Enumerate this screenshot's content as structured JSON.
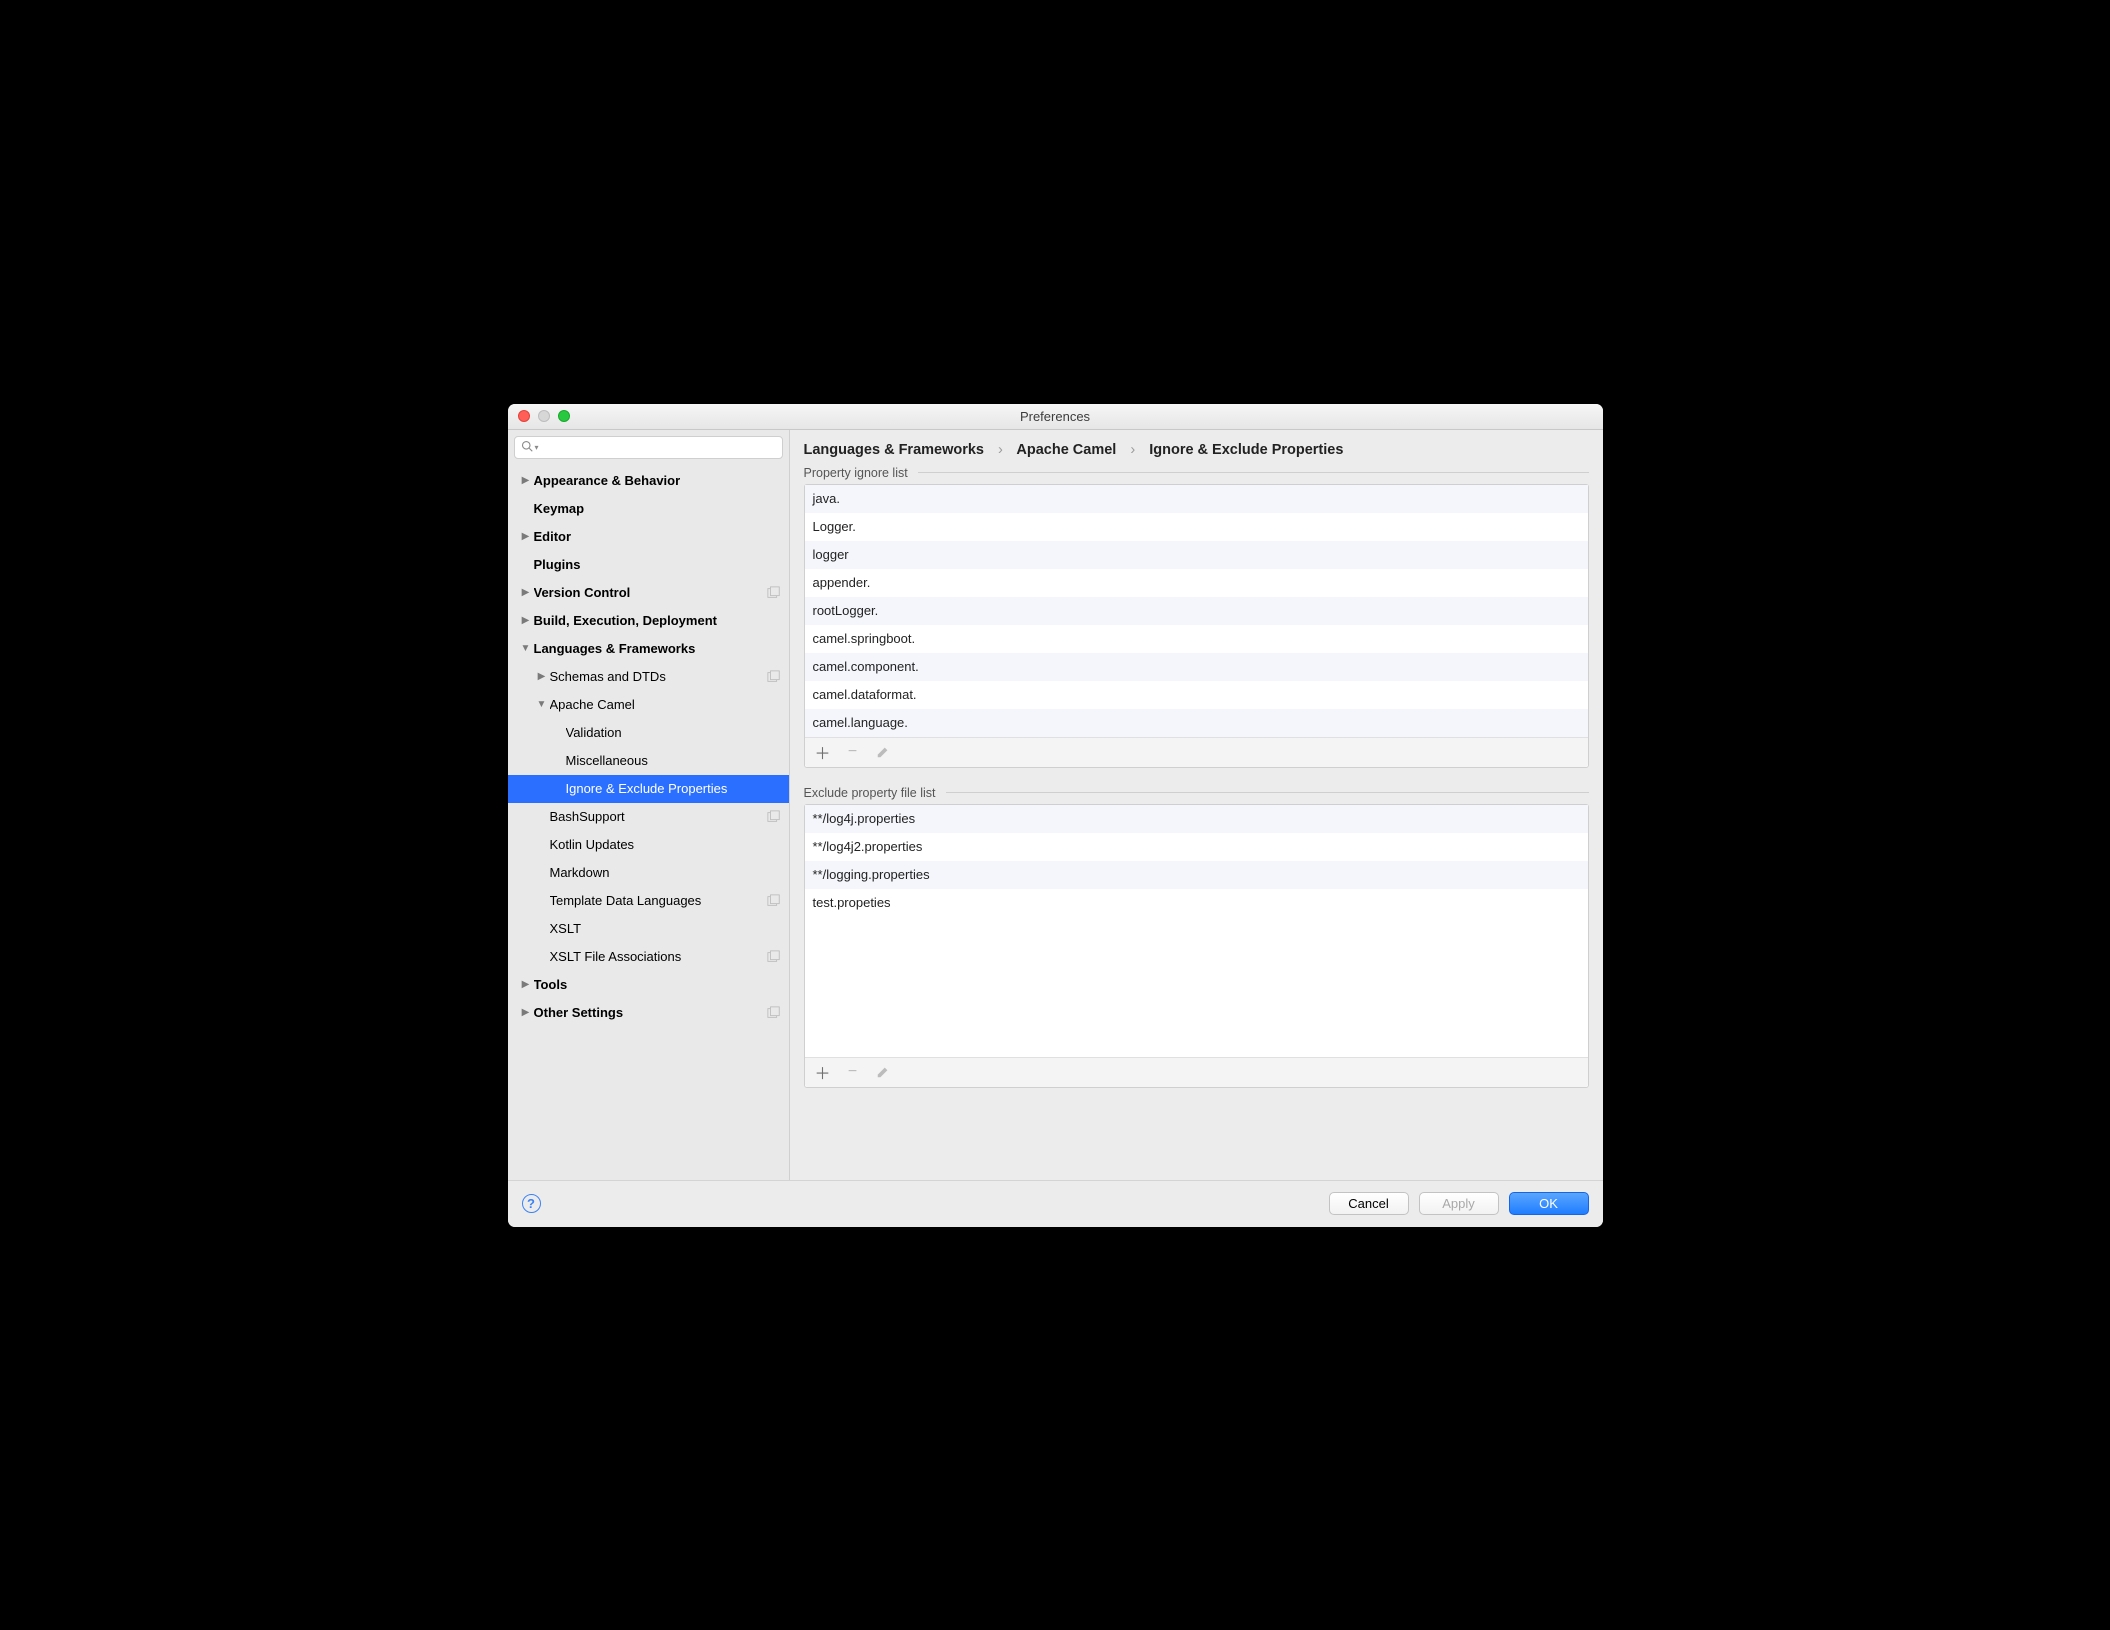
{
  "window": {
    "title": "Preferences"
  },
  "search": {
    "placeholder": ""
  },
  "breadcrumb": [
    "Languages & Frameworks",
    "Apache Camel",
    "Ignore & Exclude Properties"
  ],
  "sidebar": [
    {
      "label": "Appearance & Behavior",
      "arrow": "right",
      "bold": true,
      "indent": 0
    },
    {
      "label": "Keymap",
      "arrow": "",
      "bold": true,
      "indent": 0
    },
    {
      "label": "Editor",
      "arrow": "right",
      "bold": true,
      "indent": 0
    },
    {
      "label": "Plugins",
      "arrow": "",
      "bold": true,
      "indent": 0
    },
    {
      "label": "Version Control",
      "arrow": "right",
      "bold": true,
      "indent": 0,
      "proj": true
    },
    {
      "label": "Build, Execution, Deployment",
      "arrow": "right",
      "bold": true,
      "indent": 0
    },
    {
      "label": "Languages & Frameworks",
      "arrow": "down",
      "bold": true,
      "indent": 0
    },
    {
      "label": "Schemas and DTDs",
      "arrow": "right",
      "bold": false,
      "indent": 1,
      "proj": true
    },
    {
      "label": "Apache Camel",
      "arrow": "down",
      "bold": false,
      "indent": 1
    },
    {
      "label": "Validation",
      "arrow": "",
      "bold": false,
      "indent": 2
    },
    {
      "label": "Miscellaneous",
      "arrow": "",
      "bold": false,
      "indent": 2
    },
    {
      "label": "Ignore & Exclude Properties",
      "arrow": "",
      "bold": false,
      "indent": 2,
      "selected": true
    },
    {
      "label": "BashSupport",
      "arrow": "",
      "bold": false,
      "indent": 1,
      "proj": true
    },
    {
      "label": "Kotlin Updates",
      "arrow": "",
      "bold": false,
      "indent": 1
    },
    {
      "label": "Markdown",
      "arrow": "",
      "bold": false,
      "indent": 1
    },
    {
      "label": "Template Data Languages",
      "arrow": "",
      "bold": false,
      "indent": 1,
      "proj": true
    },
    {
      "label": "XSLT",
      "arrow": "",
      "bold": false,
      "indent": 1
    },
    {
      "label": "XSLT File Associations",
      "arrow": "",
      "bold": false,
      "indent": 1,
      "proj": true
    },
    {
      "label": "Tools",
      "arrow": "right",
      "bold": true,
      "indent": 0
    },
    {
      "label": "Other Settings",
      "arrow": "right",
      "bold": true,
      "indent": 0,
      "proj": true
    }
  ],
  "sections": {
    "ignore": {
      "title": "Property ignore list",
      "items": [
        "java.",
        "Logger.",
        "logger",
        "appender.",
        "rootLogger.",
        "camel.springboot.",
        "camel.component.",
        "camel.dataformat.",
        "camel.language."
      ]
    },
    "exclude": {
      "title": "Exclude property file list",
      "items": [
        "**/log4j.properties",
        "**/log4j2.properties",
        "**/logging.properties",
        "test.propeties"
      ]
    }
  },
  "buttons": {
    "cancel": "Cancel",
    "apply": "Apply",
    "ok": "OK"
  }
}
